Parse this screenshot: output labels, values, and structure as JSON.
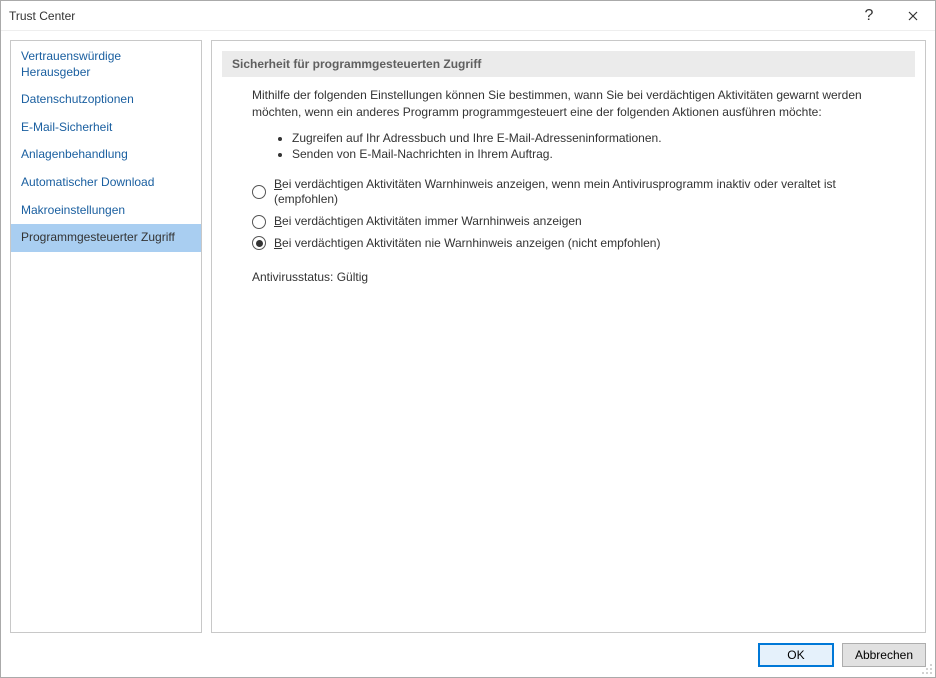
{
  "window": {
    "title": "Trust Center"
  },
  "titlebar": {
    "help_tooltip": "?",
    "close_tooltip": "×"
  },
  "sidebar": {
    "items": [
      {
        "label": "Vertrauenswürdige Herausgeber",
        "selected": false
      },
      {
        "label": "Datenschutzoptionen",
        "selected": false
      },
      {
        "label": "E-Mail-Sicherheit",
        "selected": false
      },
      {
        "label": "Anlagenbehandlung",
        "selected": false
      },
      {
        "label": "Automatischer Download",
        "selected": false
      },
      {
        "label": "Makroeinstellungen",
        "selected": false
      },
      {
        "label": "Programmgesteuerter Zugriff",
        "selected": true
      }
    ]
  },
  "main": {
    "section_title": "Sicherheit für programmgesteuerten Zugriff",
    "intro": "Mithilfe der folgenden Einstellungen können Sie bestimmen, wann Sie bei verdächtigen Aktivitäten gewarnt werden möchten, wenn ein anderes Programm programmgesteuert eine der folgenden Aktionen ausführen möchte:",
    "bullets": [
      "Zugreifen auf Ihr Adressbuch und Ihre E-Mail-Adresseninformationen.",
      "Senden von E-Mail-Nachrichten in Ihrem Auftrag."
    ],
    "options": [
      {
        "label_pre": "B",
        "label_rest": "ei verdächtigen Aktivitäten Warnhinweis anzeigen, wenn mein Antivirusprogramm inaktiv oder veraltet ist (empfohlen)",
        "checked": false
      },
      {
        "label_pre": "B",
        "label_rest": "ei verdächtigen Aktivitäten immer Warnhinweis anzeigen",
        "checked": false
      },
      {
        "label_pre": "B",
        "label_rest": "ei verdächtigen Aktivitäten nie Warnhinweis anzeigen (nicht empfohlen)",
        "checked": true
      }
    ],
    "antivirus_label": "Antivirusstatus:",
    "antivirus_value": "Gültig"
  },
  "footer": {
    "ok_label": "OK",
    "cancel_label": "Abbrechen"
  }
}
